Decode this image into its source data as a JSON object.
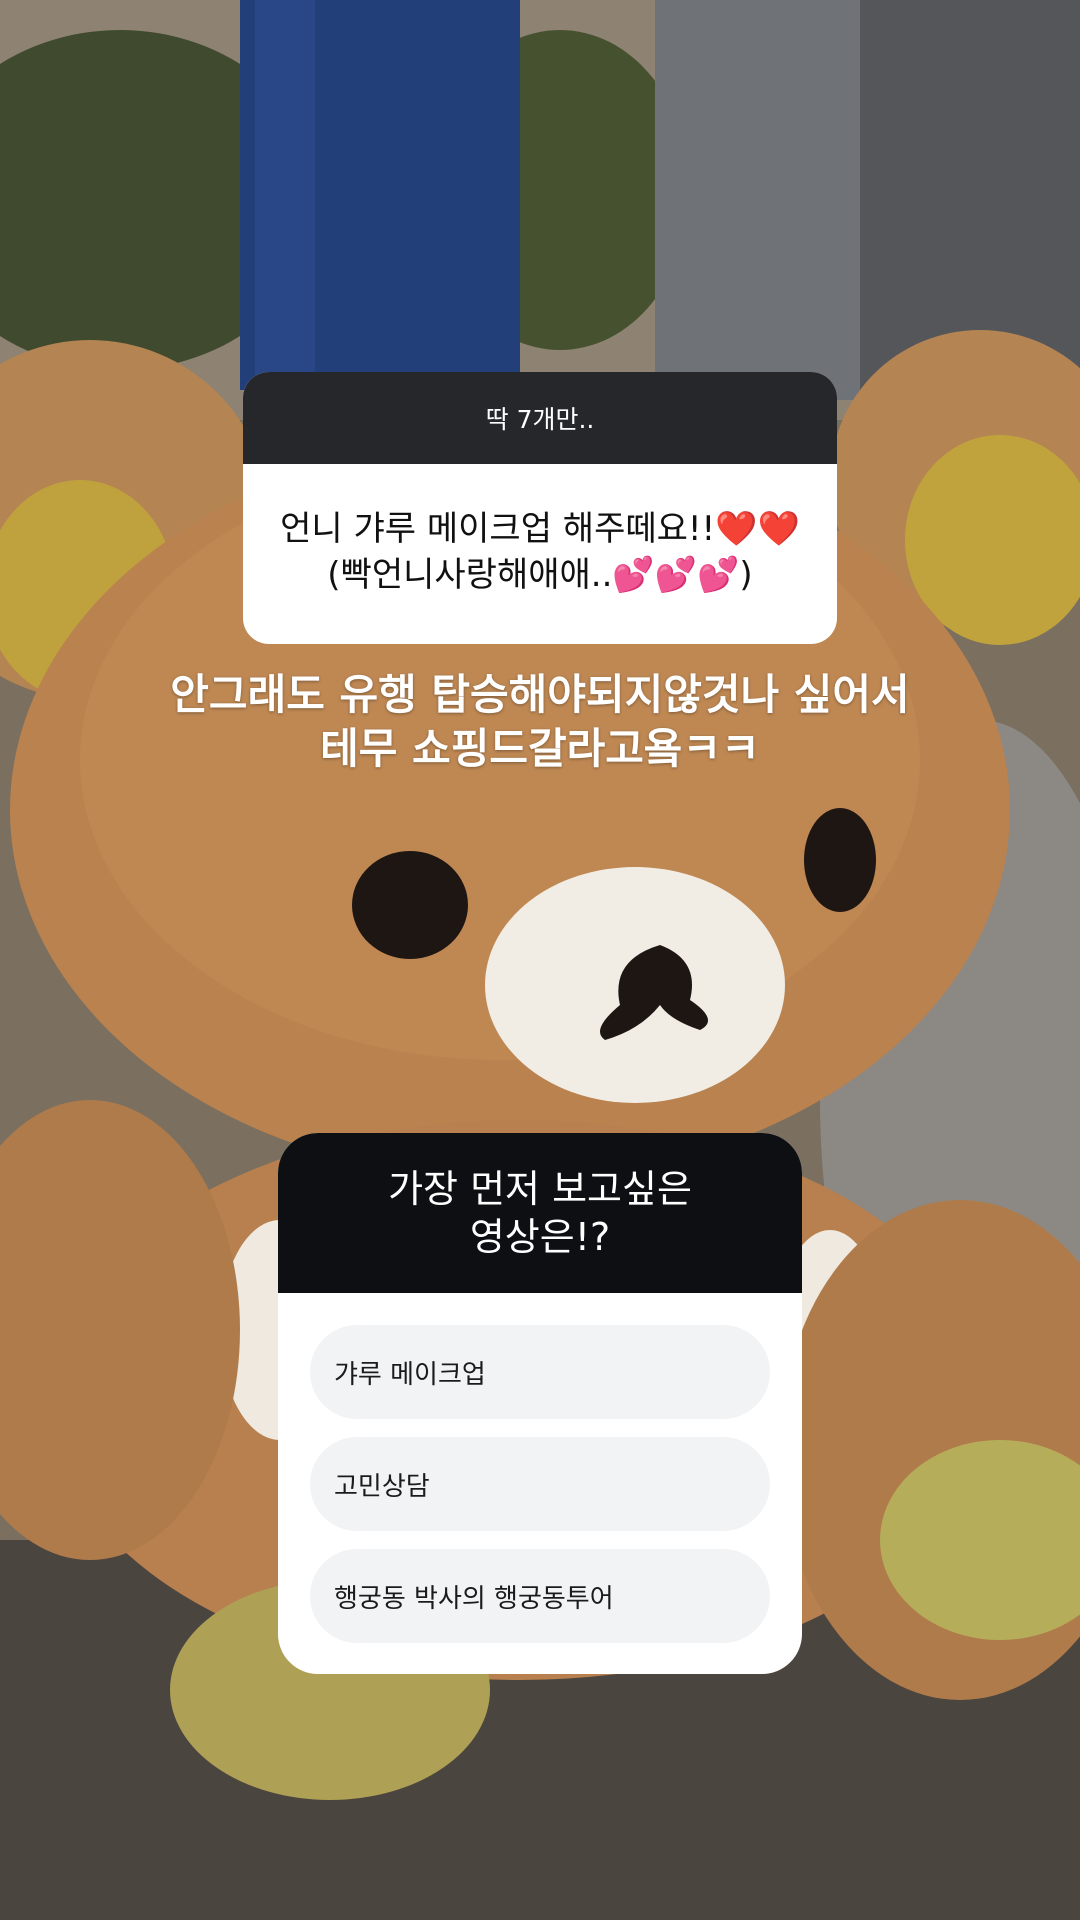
{
  "question_sticker": {
    "prompt": "딱 7개만..",
    "answer_line1": "언니 갸루 메이크업 해주떼요!!❤️❤️",
    "answer_line2": "(빡언니사랑해애애..💕💕💕)"
  },
  "caption": {
    "line1": "안그래도 유행 탑승해야되지않것나 싶어서",
    "line2": "테무 쇼핑드갈라고욬ㅋㅋ"
  },
  "quiz_sticker": {
    "title_line1": "가장 먼저 보고싶은",
    "title_line2": "영상은!?",
    "options": [
      {
        "label": "갸루 메이크업"
      },
      {
        "label": "고민상담"
      },
      {
        "label": "행궁동 박사의 행궁동투어"
      }
    ]
  },
  "colors": {
    "question_header": "#26272b",
    "quiz_header": "#0e0f13",
    "option_bg": "#f2f3f5"
  }
}
